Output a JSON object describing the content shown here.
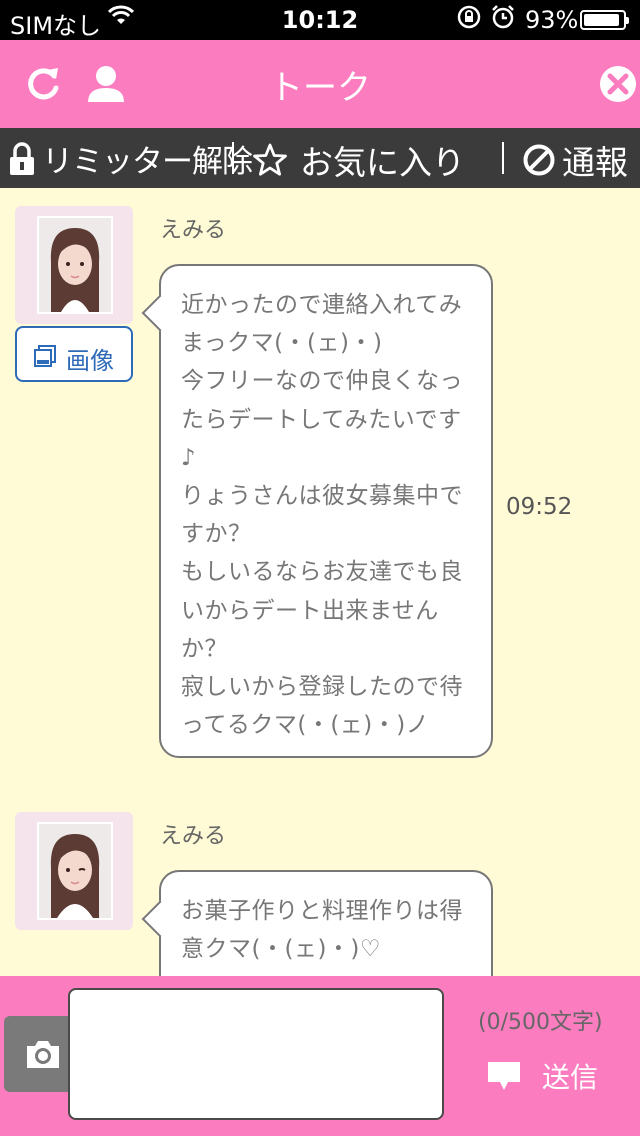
{
  "status_bar": {
    "carrier": "SIMなし",
    "time": "10:12",
    "battery": "93%",
    "battery_level": 0.93
  },
  "header": {
    "title": "トーク",
    "icons": [
      "refresh-icon",
      "profile-icon",
      "close-icon"
    ]
  },
  "toolbar": {
    "limiter": "リミッター解除",
    "favorite": "お気に入り",
    "report": "通報"
  },
  "messages": [
    {
      "sender": "えみる",
      "image_button": "画像",
      "lines": [
        "近かったので連絡入れてみ",
        "まっクマ(・(ェ)・)",
        "今フリーなので仲良くなっ",
        "たらデートしてみたいです",
        "♪",
        "りょうさんは彼女募集中で",
        "すか？",
        "もしいるならお友達でも良",
        "いからデート出来ません",
        "か？",
        "寂しいから登録したので待",
        "ってるクマ(・(ェ)・)ノ"
      ],
      "time": "09:52"
    },
    {
      "sender": "えみる",
      "lines": [
        "お菓子作りと料理作りは得",
        "意クマ(・(ェ)・)♡"
      ]
    }
  ],
  "footer": {
    "input_value": "",
    "counter": "(0/500文字)",
    "send_label": "送信"
  },
  "colors": {
    "header_pink": "#fb7dc0",
    "toolbar_dark": "#3b3b3b",
    "chat_background": "#fffbd6",
    "image_button_blue": "#2d6ab8"
  }
}
